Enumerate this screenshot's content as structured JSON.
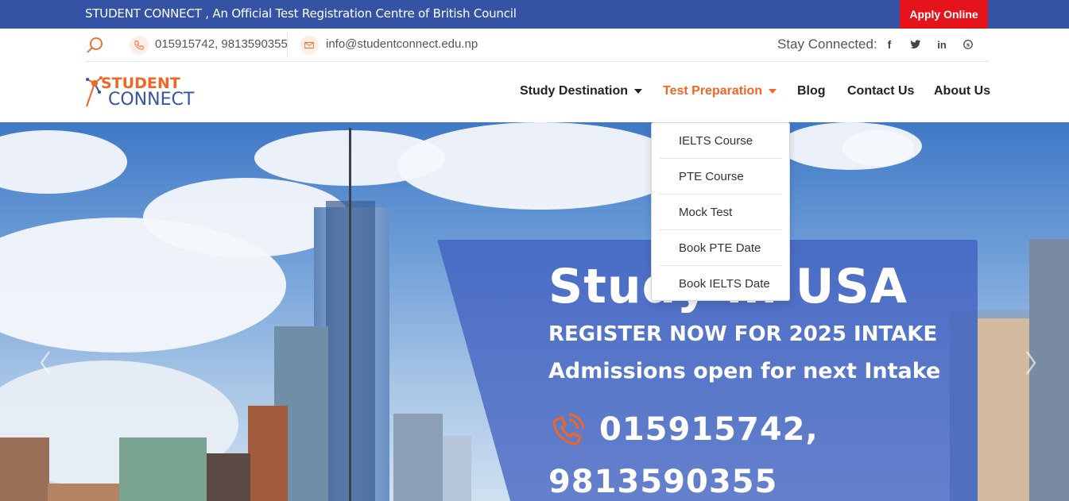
{
  "topbar": {
    "tagline": "STUDENT CONNECT , An Official Test Registration Centre of British Council",
    "apply_label": "Apply Online"
  },
  "contact": {
    "phone": "015915742, 9813590355",
    "email": "info@studentconnect.edu.np",
    "stay_connected": "Stay Connected:",
    "social": [
      "f",
      "t",
      "in",
      "s"
    ],
    "icons": [
      "search-icon",
      "phone-icon",
      "email-icon",
      "facebook-icon",
      "twitter-icon",
      "linkedin-icon",
      "skype-icon"
    ]
  },
  "logo": {
    "line1": "STUDENT",
    "line2": "CONNECT"
  },
  "nav": {
    "items": [
      {
        "label": "Study Destination"
      },
      {
        "label": "Test Preparation"
      },
      {
        "label": "Blog"
      },
      {
        "label": "Contact Us"
      },
      {
        "label": "About Us"
      }
    ]
  },
  "dropdown": {
    "items": [
      "IELTS Course",
      "PTE Course",
      "Mock Test",
      "Book PTE Date",
      "Book IELTS Date"
    ]
  },
  "hero": {
    "title": "Study in USA",
    "subtitle1": "REGISTER NOW FOR 2025 INTAKE",
    "subtitle2": "Admissions open for next Intake",
    "phone_line1": "015915742,",
    "phone_line2": "9813590355"
  },
  "colors": {
    "brand_blue": "#3553a5",
    "accent_orange": "#f26522",
    "apply_red": "#e5131b"
  }
}
